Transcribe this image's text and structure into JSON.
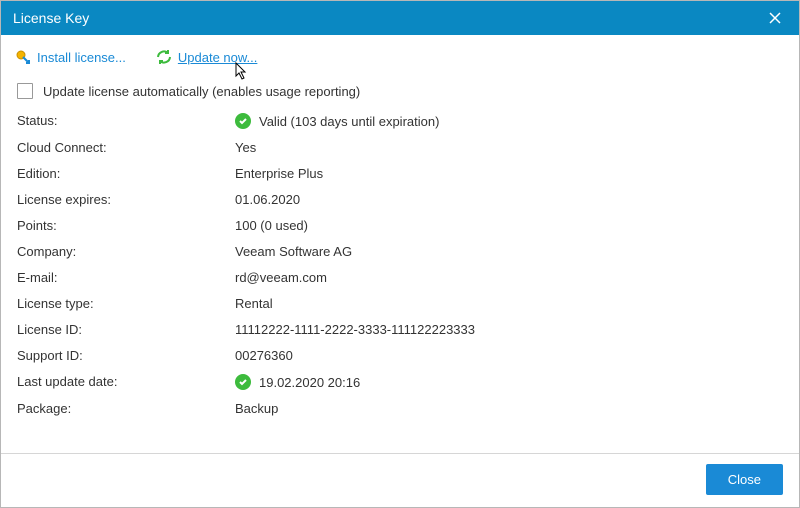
{
  "title": "License Key",
  "toolbar": {
    "install_label": "Install license...",
    "update_label": "Update now..."
  },
  "checkbox_label": "Update license automatically (enables usage reporting)",
  "fields": {
    "status": {
      "label": "Status:",
      "value": "Valid (103 days until expiration)",
      "icon": true
    },
    "cloud_connect": {
      "label": "Cloud Connect:",
      "value": "Yes"
    },
    "edition": {
      "label": "Edition:",
      "value": "Enterprise Plus"
    },
    "expires": {
      "label": "License expires:",
      "value": "01.06.2020"
    },
    "points": {
      "label": "Points:",
      "value": "100 (0 used)"
    },
    "company": {
      "label": "Company:",
      "value": "Veeam Software AG"
    },
    "email": {
      "label": "E-mail:",
      "value": "rd@veeam.com"
    },
    "license_type": {
      "label": "License type:",
      "value": "Rental"
    },
    "license_id": {
      "label": "License ID:",
      "value": "11112222-1111-2222-3333-111122223333"
    },
    "support_id": {
      "label": "Support ID:",
      "value": "00276360"
    },
    "last_update": {
      "label": "Last update date:",
      "value": "19.02.2020 20:16",
      "icon": true
    },
    "package": {
      "label": "Package:",
      "value": "Backup"
    }
  },
  "footer": {
    "close_label": "Close"
  }
}
